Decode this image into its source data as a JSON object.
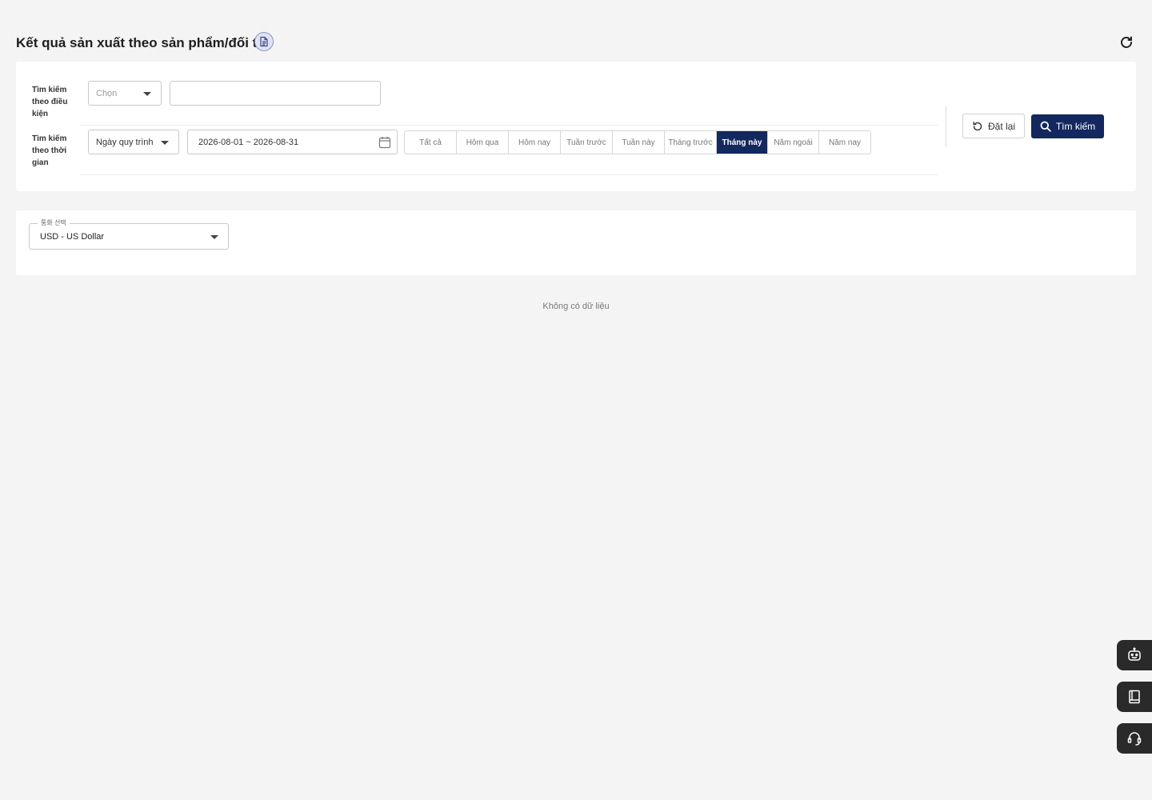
{
  "header": {
    "title": "Kết quả sản xuất theo sản phẩm/đối tác"
  },
  "search": {
    "condition_label": "Tìm kiếm theo điều kiện",
    "condition_select_placeholder": "Chọn",
    "condition_input_value": "",
    "time_label": "Tìm kiếm theo thời gian",
    "time_type_selected": "Ngày quy trình",
    "date_range": "2026-08-01 ~ 2026-08-31",
    "periods": [
      {
        "label": "Tất cả",
        "active": false
      },
      {
        "label": "Hôm qua",
        "active": false
      },
      {
        "label": "Hôm nay",
        "active": false
      },
      {
        "label": "Tuần trước",
        "active": false
      },
      {
        "label": "Tuần này",
        "active": false
      },
      {
        "label": "Tháng trước",
        "active": false
      },
      {
        "label": "Tháng này",
        "active": true
      },
      {
        "label": "Năm ngoái",
        "active": false
      },
      {
        "label": "Năm nay",
        "active": false
      }
    ],
    "reset_label": "Đặt lại",
    "search_label": "Tìm kiếm"
  },
  "currency": {
    "legend": "통화 선택",
    "selected": "USD - US Dollar"
  },
  "empty_state": "Không có dữ liệu",
  "colors": {
    "primary": "#13285e",
    "background": "#f4f4f4",
    "floating": "#2a2a2a"
  },
  "floating_icons": [
    "chatbot-icon",
    "manual-book-icon",
    "support-headset-icon"
  ]
}
